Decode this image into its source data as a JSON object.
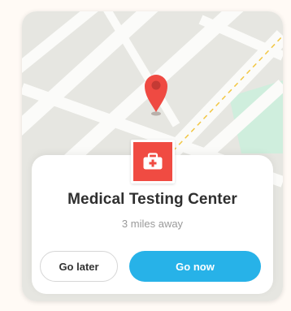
{
  "colors": {
    "map_background": "#e6e6e1",
    "road": "#fbfbf9",
    "park": "#cfeedd",
    "pin": "#ef4a42",
    "badge": "#f04b42",
    "primary_button": "#27b2e8"
  },
  "map": {
    "pin_icon": "location-pin-icon"
  },
  "place": {
    "icon": "medical-kit-icon",
    "name": "Medical Testing Center",
    "distance": "3 miles away"
  },
  "actions": {
    "go_later_label": "Go later",
    "go_now_label": "Go now"
  }
}
